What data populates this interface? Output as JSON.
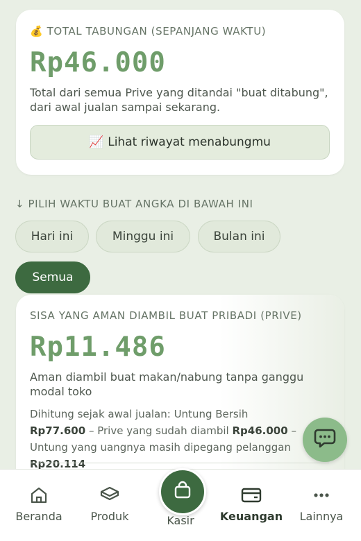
{
  "total_card": {
    "emoji": "💰",
    "title": "TOTAL TABUNGAN (SEPANJANG WAKTU)",
    "amount": "Rp46.000",
    "description": "Total dari semua Prive yang ditandai \"buat ditabung\", dari awal jualan sampai sekarang.",
    "button_emoji": "📈",
    "button_label": "Lihat riwayat menabungmu"
  },
  "period": {
    "label": "↓ PILIH WAKTU BUAT ANGKA DI BAWAH INI",
    "options": [
      "Hari ini",
      "Minggu ini",
      "Bulan ini",
      "Semua"
    ],
    "selected": "Semua"
  },
  "prive_card": {
    "title": "SISA YANG AMAN DIAMBIL BUAT PRIBADI (PRIVE)",
    "amount": "Rp11.486",
    "description": "Aman diambil buat makan/nabung tanpa ganggu modal toko",
    "calc_prefix": "Dihitung sejak awal jualan: Untung Bersih ",
    "net_profit": "Rp77.600",
    "calc_mid1": " – Prive yang sudah diambil ",
    "prive_taken": "Rp46.000",
    "calc_mid2": " – Untung yang uangnya masih dipegang pelanggan ",
    "customer_held": "Rp20.114"
  },
  "nav": {
    "items": [
      {
        "label": "Beranda",
        "icon": "home-icon"
      },
      {
        "label": "Produk",
        "icon": "box-icon"
      },
      {
        "label": "Kasir",
        "icon": "bag-icon"
      },
      {
        "label": "Keuangan",
        "icon": "wallet-icon"
      },
      {
        "label": "Lainnya",
        "icon": "more-icon"
      }
    ],
    "active": "Keuangan"
  },
  "colors": {
    "accent": "#3d6a40",
    "amount": "#6f9d6a",
    "background": "#e9efe5",
    "fab": "#8cbb8a"
  }
}
